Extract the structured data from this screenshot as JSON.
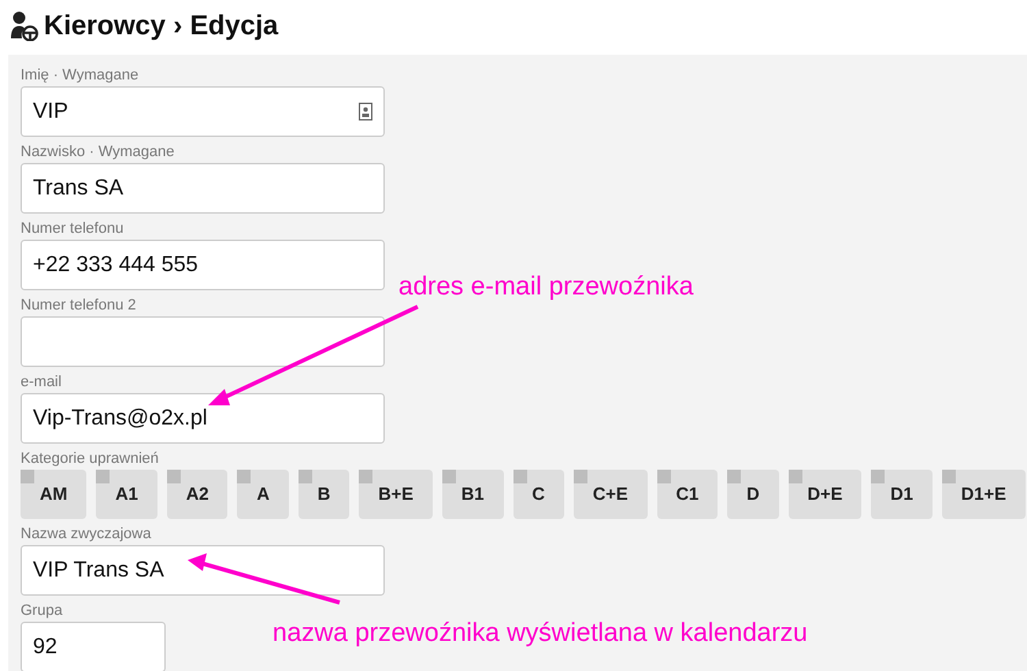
{
  "header": {
    "title": "Kierowcy › Edycja"
  },
  "fields": [
    {
      "label": "Imię · Wymagane",
      "value": "VIP",
      "kind": "contact"
    },
    {
      "label": "Nazwisko · Wymagane",
      "value": "Trans SA",
      "kind": "text"
    },
    {
      "label": "Numer telefonu",
      "value": "+22 333 444 555",
      "kind": "text"
    },
    {
      "label": "Numer telefonu 2",
      "kind": "text"
    },
    {
      "label": "e-mail",
      "value": "Vip-Trans@o2x.pl",
      "kind": "text"
    }
  ],
  "categories": {
    "label": "Kategorie uprawnień",
    "items": [
      {
        "label": "AM",
        "checked": false
      },
      {
        "label": "A1",
        "checked": false
      },
      {
        "label": "A2",
        "checked": false
      },
      {
        "label": "A",
        "checked": false
      },
      {
        "label": "B",
        "checked": false
      },
      {
        "label": "B+E",
        "checked": false
      },
      {
        "label": "B1",
        "checked": false
      },
      {
        "label": "C",
        "checked": false
      },
      {
        "label": "C+E",
        "checked": false
      },
      {
        "label": "C1",
        "checked": false
      },
      {
        "label": "D",
        "checked": false
      },
      {
        "label": "D+E",
        "checked": false
      },
      {
        "label": "D1",
        "checked": false
      },
      {
        "label": "D1+E",
        "checked": false
      }
    ]
  },
  "fields_2": [
    {
      "label": "Nazwa zwyczajowa",
      "value": "VIP Trans SA",
      "kind": "text"
    },
    {
      "label": "Grupa",
      "value": "92",
      "kind": "short"
    }
  ],
  "annotations": [
    "adres e-mail przewoźnika",
    "nazwa przewoźnika wyświetlana w kalendarzu"
  ]
}
